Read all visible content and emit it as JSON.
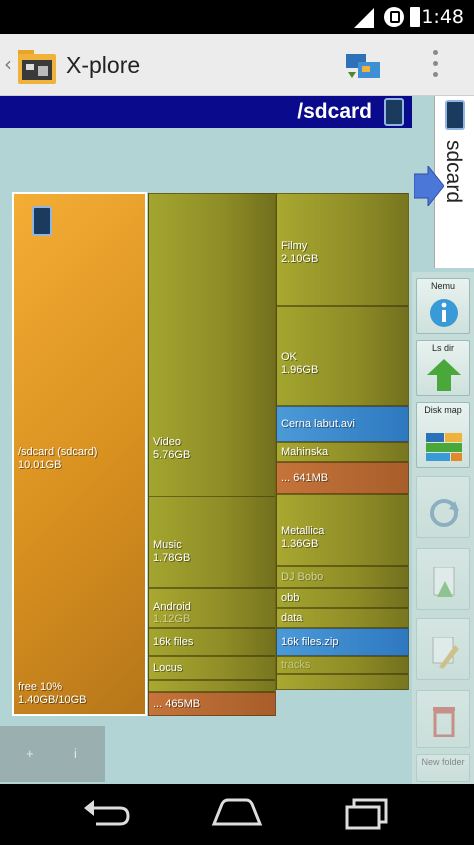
{
  "status_bar": {
    "time": "11:48"
  },
  "app_bar": {
    "up_glyph": "‹",
    "title": "X-plore",
    "app_icon": "app-folder-icon",
    "operations_icon": "file-operations-icon",
    "menu_icon": "overflow-menu-icon"
  },
  "path_bar": {
    "path": "/sdcard"
  },
  "side_tab": {
    "label": "sdcard"
  },
  "side_buttons": [
    {
      "label": "Nemu",
      "icon": "info-icon"
    },
    {
      "label": "Ls dir",
      "icon": "up-arrow-icon"
    },
    {
      "label": "Disk map",
      "icon": "disk-map-icon"
    },
    {
      "label": "",
      "icon": "refresh-icon"
    },
    {
      "label": "",
      "icon": "document-icon"
    },
    {
      "label": "",
      "icon": "edit-icon"
    },
    {
      "label": "",
      "icon": "trash-icon"
    },
    {
      "label": "New folder",
      "icon": "new-folder-icon"
    }
  ],
  "treemap": {
    "root": {
      "name": "/sdcard (sdcard)",
      "size": "10.01GB",
      "free": "free 10%",
      "free_detail": "1.40GB/10GB"
    },
    "video": {
      "name": "Video",
      "size": "5.76GB"
    },
    "filmy": {
      "name": "Filmy",
      "size": "2.10GB"
    },
    "ok": {
      "name": "OK",
      "size": "1.96GB"
    },
    "cerna": {
      "name": "Cerna labut.avi"
    },
    "mahinska": {
      "name": "Mahinska"
    },
    "video_other": {
      "name": "... 641MB"
    },
    "music": {
      "name": "Music",
      "size": "1.78GB"
    },
    "metallica": {
      "name": "Metallica",
      "size": "1.36GB"
    },
    "music_sub": {
      "name": "DJ Bobo"
    },
    "android": {
      "name": "Android",
      "sub": "1.12GB"
    },
    "obb": {
      "name": "obb"
    },
    "data": {
      "name": "data"
    },
    "files16k": {
      "name": "16k files"
    },
    "files16k_zip": {
      "name": "16k files.zip"
    },
    "files16k_sub": {
      "name": "tracks"
    },
    "locus": {
      "name": "Locus"
    },
    "other": {
      "name": "... 465MB"
    }
  },
  "bottom_panel": {
    "item_a": "+",
    "item_b": "i"
  },
  "nav_bar": {
    "back": "back-icon",
    "home": "home-icon",
    "recents": "recents-icon"
  }
}
